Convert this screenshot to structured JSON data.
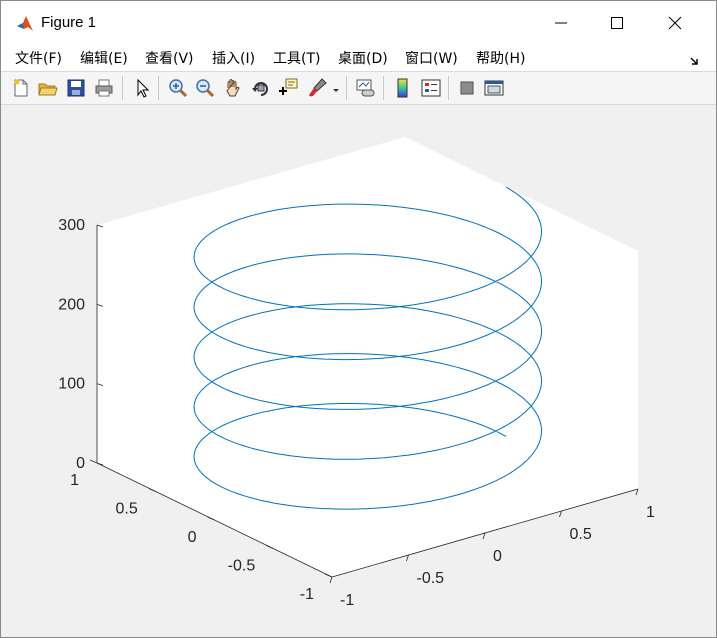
{
  "window": {
    "title": "Figure 1"
  },
  "menu": {
    "items": [
      "文件(F)",
      "编辑(E)",
      "查看(V)",
      "插入(I)",
      "工具(T)",
      "桌面(D)",
      "窗口(W)",
      "帮助(H)"
    ]
  },
  "toolbar": {
    "buttons": [
      "new-figure-icon",
      "open-file-icon",
      "save-icon",
      "print-icon",
      "select-pointer-icon",
      "zoom-in-icon",
      "zoom-out-icon",
      "pan-hand-icon",
      "rotate-3d-icon",
      "data-cursor-icon",
      "brush-icon",
      "link-plot-icon",
      "colorbar-icon",
      "legend-icon",
      "hide-plot-tools-icon",
      "show-plot-tools-icon"
    ]
  },
  "colors": {
    "line": "#0072bd",
    "axes_background": "#ffffff",
    "figure_background": "#f0f0f0"
  },
  "chart_data": {
    "type": "line",
    "projection": "3d",
    "title": "",
    "xlabel": "",
    "ylabel": "",
    "zlabel": "",
    "xlim": [
      -1,
      1
    ],
    "ylim": [
      -1,
      1
    ],
    "zlim": [
      0,
      300
    ],
    "x_ticks": [
      "-1",
      "-0.5",
      "0",
      "0.5",
      "1"
    ],
    "y_ticks": [
      "-1",
      "-0.5",
      "0",
      "0.5",
      "1"
    ],
    "z_ticks": [
      "0",
      "100",
      "200",
      "300"
    ],
    "grid": false,
    "series": [
      {
        "x_expr": "sin(t)",
        "y_expr": "cos(t)",
        "z_expr": "t",
        "t_range": [
          0,
          10
        ],
        "t_step_note": "t from 0 to 10*pi",
        "t": [
          0,
          31.4159
        ],
        "z_max": 314.159
      }
    ]
  }
}
